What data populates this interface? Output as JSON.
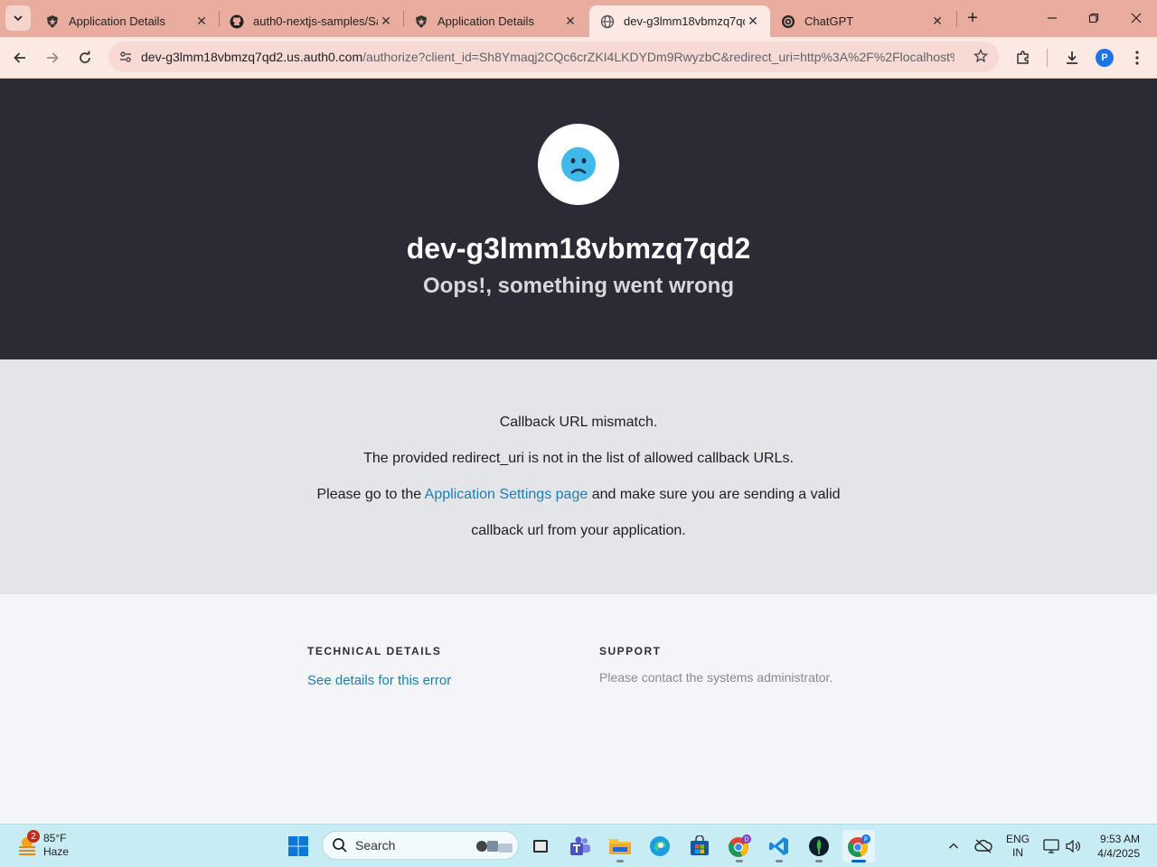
{
  "browser": {
    "tabs": [
      {
        "title": "Application Details",
        "icon": "auth0-shield-icon",
        "active": false
      },
      {
        "title": "auth0-nextjs-samples/Sa",
        "icon": "github-icon",
        "active": false
      },
      {
        "title": "Application Details",
        "icon": "auth0-shield-icon",
        "active": false
      },
      {
        "title": "dev-g3lmm18vbmzq7qd",
        "icon": "globe-icon",
        "active": true
      },
      {
        "title": "ChatGPT",
        "icon": "chatgpt-icon",
        "active": false
      }
    ],
    "url_host": "dev-g3lmm18vbmzq7qd2.us.auth0.com",
    "url_rest": "/authorize?client_id=Sh8Ymaqj2CQc6crZKI4LKDYDm9RwyzbC&redirect_uri=http%3A%2F%2Flocalhost%...",
    "profile_initial": "P"
  },
  "page": {
    "tenant": "dev-g3lmm18vbmzq7qd2",
    "headline": "Oops!, something went wrong",
    "message": {
      "line1": "Callback URL mismatch.",
      "line2": "The provided redirect_uri is not in the list of allowed callback URLs.",
      "line3_before": "Please go to the ",
      "line3_link": "Application Settings page",
      "line3_after": " and make sure you are sending a valid",
      "line4": "callback url from your application."
    },
    "technical": {
      "title": "TECHNICAL DETAILS",
      "link": "See details for this error"
    },
    "support": {
      "title": "SUPPORT",
      "text": "Please contact the systems administrator."
    }
  },
  "taskbar": {
    "weather_temp": "85°F",
    "weather_desc": "Haze",
    "weather_badge": "2",
    "search_label": "Search",
    "lang_top": "ENG",
    "lang_bottom": "IN",
    "time": "9:53 AM",
    "date": "4/4/2025"
  },
  "colors": {
    "hero_bg": "#2a2b34",
    "link": "#1a7fb5",
    "tab_strip": "#e9ada0",
    "face": "#3fb9e9"
  }
}
